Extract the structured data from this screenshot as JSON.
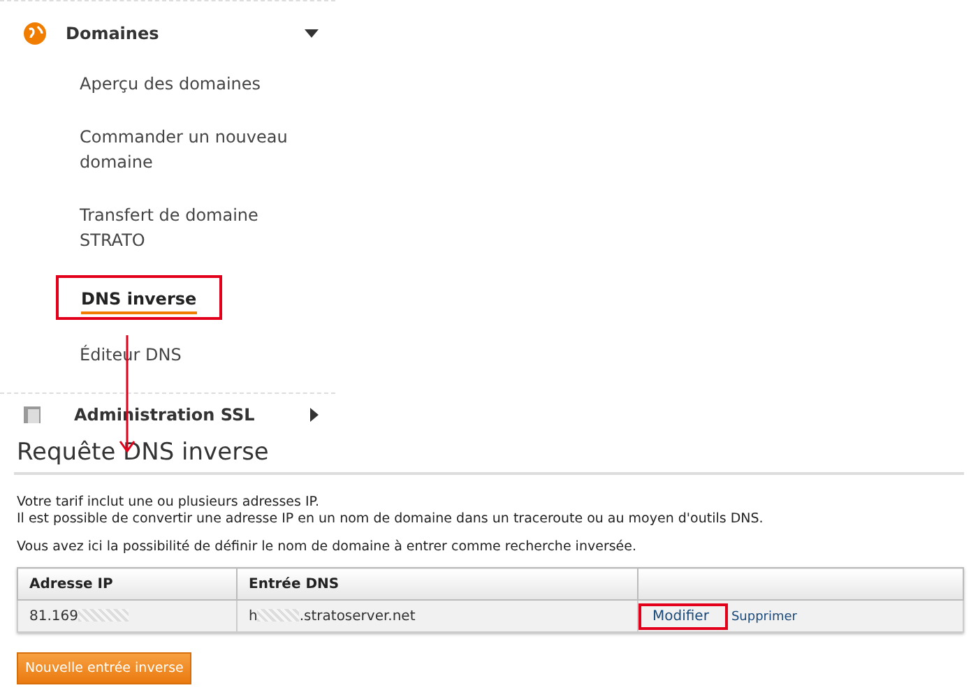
{
  "sidebar": {
    "section": {
      "label": "Domaines",
      "expanded": true
    },
    "items": [
      {
        "label": "Aperçu des domaines",
        "selected": false,
        "highlighted": false
      },
      {
        "label": "Commander un nouveau domaine",
        "selected": false,
        "highlighted": false
      },
      {
        "label": "Transfert de domaine STRATO",
        "selected": false,
        "highlighted": false
      },
      {
        "label": "DNS inverse",
        "selected": true,
        "highlighted": true
      },
      {
        "label": "Éditeur DNS",
        "selected": false,
        "highlighted": false
      }
    ],
    "next_section": {
      "label": "Administration SSL",
      "expanded": false
    }
  },
  "main": {
    "title": "Requête DNS inverse",
    "paragraphs": [
      "Votre tarif inclut une ou plusieurs adresses IP.\nIl est possible de convertir une adresse IP en un nom de domaine dans un traceroute ou au moyen d'outils DNS.",
      "Vous avez ici la possibilité de définir le nom de domaine à entrer comme recherche inversée."
    ],
    "table": {
      "columns": [
        "Adresse IP",
        "Entrée DNS"
      ],
      "rows": [
        {
          "ip": "81.169",
          "ip_redacted": true,
          "dns_start": "h",
          "dns_end": ".stratoserver.net",
          "dns_redacted": true,
          "actions": [
            {
              "label": "Modifier",
              "highlighted": true
            },
            {
              "label": "Supprimer",
              "highlighted": false
            }
          ]
        }
      ]
    },
    "button": "Nouvelle entrée inverse"
  }
}
